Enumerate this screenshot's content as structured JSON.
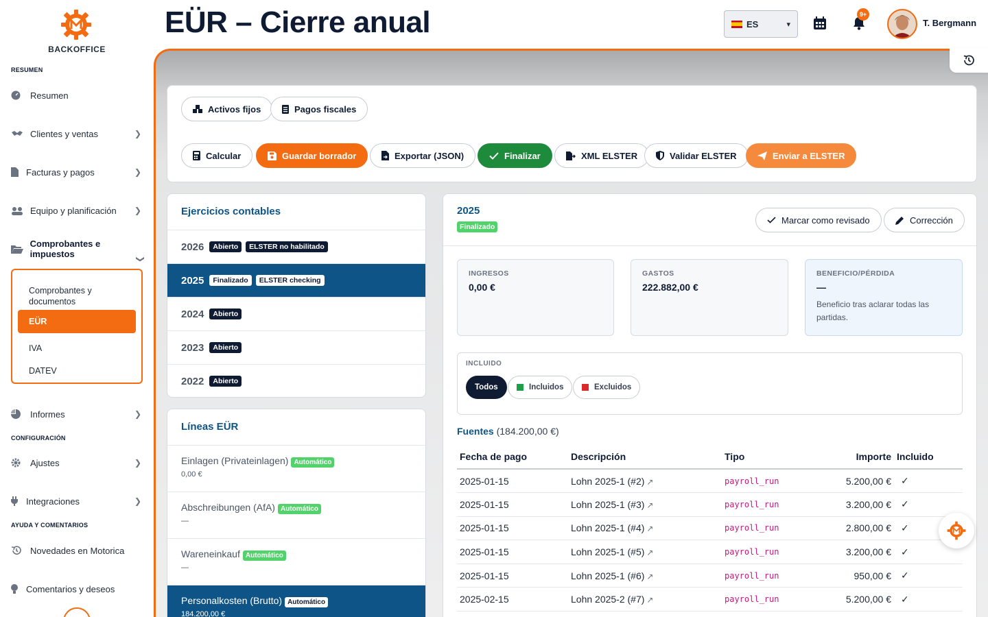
{
  "app": {
    "brand": "BACKOFFICE",
    "page_title": "EÜR – Cierre anual"
  },
  "header": {
    "language": "ES",
    "notifications_badge": "9+",
    "user_name": "T. Bergmann"
  },
  "sidebar": {
    "sections": {
      "resumen": "RESUMEN",
      "configuracion": "CONFIGURACIÓN",
      "ayuda": "AYUDA Y COMENTARIOS"
    },
    "items": {
      "resumen": "Resumen",
      "clientes": "Clientes y ventas",
      "facturas": "Facturas y pagos",
      "equipo": "Equipo y planificación",
      "comprobantes": "Comprobantes e impuestos",
      "informes": "Informes",
      "ajustes": "Ajustes",
      "integraciones": "Integraciones",
      "novedades": "Novedades en Motorica",
      "comentarios": "Comentarios y deseos"
    },
    "submenu": {
      "documentos": "Comprobantes y documentos",
      "eur": "EÜR",
      "iva": "IVA",
      "datev": "DATEV"
    }
  },
  "toolbar": {
    "activos_fijos": "Activos fijos",
    "pagos_fiscales": "Pagos fiscales",
    "calcular": "Calcular",
    "guardar_borrador": "Guardar borrador",
    "exportar_json": "Exportar (JSON)",
    "finalizar": "Finalizar",
    "xml_elster": "XML ELSTER",
    "validar_elster": "Validar ELSTER",
    "enviar_elster": "Enviar a ELSTER"
  },
  "fiscal_years": {
    "title": "Ejercicios contables",
    "rows": [
      {
        "year": "2026",
        "status": "Abierto",
        "extra": "ELSTER no habilitado"
      },
      {
        "year": "2025",
        "status": "Finalizado",
        "extra": "ELSTER checking"
      },
      {
        "year": "2024",
        "status": "Abierto",
        "extra": ""
      },
      {
        "year": "2023",
        "status": "Abierto",
        "extra": ""
      },
      {
        "year": "2022",
        "status": "Abierto",
        "extra": ""
      }
    ]
  },
  "eur_lines": {
    "title": "Líneas EÜR",
    "auto_label": "Automático",
    "rows": [
      {
        "name": "Einlagen (Privateinlagen)",
        "value": "0,00 €"
      },
      {
        "name": "Abschreibungen (AfA)",
        "value": "—"
      },
      {
        "name": "Wareneinkauf",
        "value": "—"
      },
      {
        "name": "Personalkosten (Brutto)",
        "value": "184.200,00 €"
      }
    ]
  },
  "detail": {
    "year": "2025",
    "status": "Finalizado",
    "mark_reviewed": "Marcar como revisado",
    "correction": "Corrección",
    "kpis": {
      "ingresos_label": "INGRESOS",
      "ingresos_value": "0,00 €",
      "gastos_label": "GASTOS",
      "gastos_value": "222.882,00 €",
      "beneficio_label": "BENEFICIO/PÉRDIDA",
      "beneficio_value": "—",
      "beneficio_note": "Beneficio tras aclarar todas las partidas."
    },
    "filter": {
      "label": "INCLUIDO",
      "todos": "Todos",
      "incluidos": "Incluidos",
      "excluidos": "Excluidos"
    },
    "sources": {
      "title": "Fuentes",
      "total": "(184.200,00 €)",
      "columns": [
        "Fecha de pago",
        "Descripción",
        "Tipo",
        "Importe",
        "Incluido"
      ],
      "rows": [
        {
          "date": "2025-01-15",
          "desc": "Lohn 2025-1 (#2)",
          "type": "payroll_run",
          "amount": "5.200,00 €",
          "included": "✓"
        },
        {
          "date": "2025-01-15",
          "desc": "Lohn 2025-1 (#3)",
          "type": "payroll_run",
          "amount": "3.200,00 €",
          "included": "✓"
        },
        {
          "date": "2025-01-15",
          "desc": "Lohn 2025-1 (#4)",
          "type": "payroll_run",
          "amount": "2.800,00 €",
          "included": "✓"
        },
        {
          "date": "2025-01-15",
          "desc": "Lohn 2025-1 (#5)",
          "type": "payroll_run",
          "amount": "3.200,00 €",
          "included": "✓"
        },
        {
          "date": "2025-01-15",
          "desc": "Lohn 2025-1 (#6)",
          "type": "payroll_run",
          "amount": "950,00 €",
          "included": "✓"
        },
        {
          "date": "2025-02-15",
          "desc": "Lohn 2025-2 (#7)",
          "type": "payroll_run",
          "amount": "5.200,00 €",
          "included": "✓"
        }
      ]
    }
  },
  "colors": {
    "accent": "#f36c12",
    "primary": "#0e5486",
    "navy": "#0f1b33",
    "success": "#1e8a3c"
  }
}
